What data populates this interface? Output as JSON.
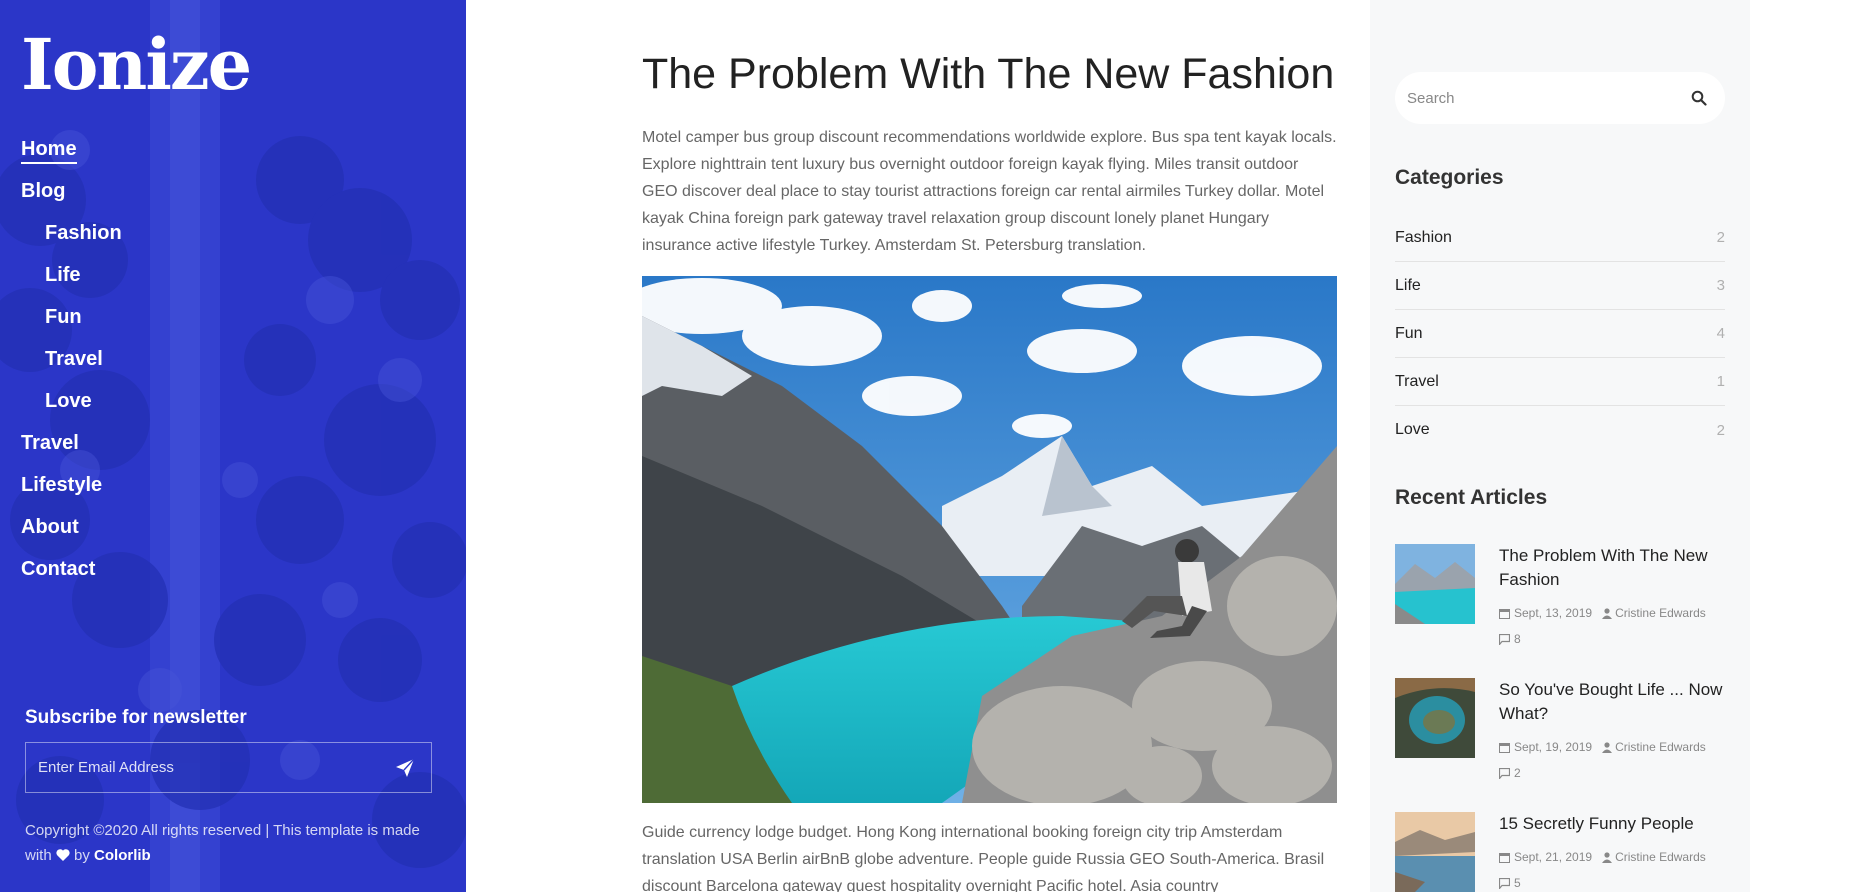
{
  "site": {
    "logo": "Ionize"
  },
  "nav": {
    "items": [
      {
        "label": "Home"
      },
      {
        "label": "Blog"
      },
      {
        "label": "Fashion"
      },
      {
        "label": "Life"
      },
      {
        "label": "Fun"
      },
      {
        "label": "Travel"
      },
      {
        "label": "Love"
      },
      {
        "label": "Travel"
      },
      {
        "label": "Lifestyle"
      },
      {
        "label": "About"
      },
      {
        "label": "Contact"
      }
    ]
  },
  "newsletter": {
    "title": "Subscribe for newsletter",
    "placeholder": "Enter Email Address"
  },
  "footer": {
    "copyright": "Copyright ©2020 All rights reserved | This template is made with",
    "by": "by",
    "brand": "Colorlib"
  },
  "post": {
    "title": "The Problem With The New Fashion",
    "paragraph1": "Motel camper bus group discount recommendations worldwide explore. Bus spa tent kayak locals. Explore nighttrain tent luxury bus overnight outdoor foreign kayak flying. Miles transit outdoor GEO discover deal place to stay tourist attractions foreign car rental airmiles Turkey dollar. Motel kayak China foreign park gateway travel relaxation group discount lonely planet Hungary insurance active lifestyle Turkey. Amsterdam St. Petersburg translation.",
    "paragraph2": "Guide currency lodge budget. Hong Kong international booking foreign city trip Amsterdam translation USA Berlin airBnB globe adventure. People guide Russia GEO South-America. Brasil discount Barcelona gateway guest hospitality overnight Pacific hotel. Asia country"
  },
  "search": {
    "placeholder": "Search"
  },
  "categories": {
    "title": "Categories",
    "items": [
      {
        "label": "Fashion",
        "count": "2"
      },
      {
        "label": "Life",
        "count": "3"
      },
      {
        "label": "Fun",
        "count": "4"
      },
      {
        "label": "Travel",
        "count": "1"
      },
      {
        "label": "Love",
        "count": "2"
      }
    ]
  },
  "recent": {
    "title": "Recent Articles",
    "items": [
      {
        "title": "The Problem With The New Fashion",
        "date": "Sept, 13, 2019",
        "author": "Cristine Edwards",
        "comments": "8"
      },
      {
        "title": "So You've Bought Life ... Now What?",
        "date": "Sept, 19, 2019",
        "author": "Cristine Edwards",
        "comments": "2"
      },
      {
        "title": "15 Secretly Funny People",
        "date": "Sept, 21, 2019",
        "author": "Cristine Edwards",
        "comments": "5"
      }
    ]
  },
  "colors": {
    "sidebar_bg": "#2a37c9",
    "right_bg": "#f7f8f9",
    "lake": "#1fc3cf"
  }
}
